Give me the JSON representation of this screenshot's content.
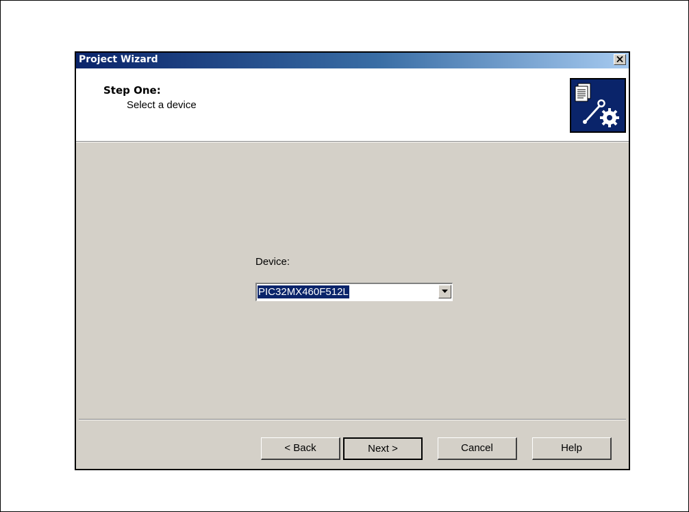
{
  "dialog": {
    "title": "Project Wizard",
    "close_icon": "close-icon"
  },
  "header": {
    "step_title": "Step One:",
    "step_subtitle": "Select a device",
    "icon": "wizard-document-wrench-gear-icon"
  },
  "device": {
    "label": "Device:",
    "selected_value": "PIC32MX460F512L",
    "dropdown_icon": "chevron-down-icon"
  },
  "buttons": {
    "back": "< Back",
    "next": "Next >",
    "cancel": "Cancel",
    "help": "Help"
  },
  "colors": {
    "title_bar_start": "#0a246a",
    "title_bar_end": "#a6caf0",
    "dialog_face": "#d4d0c8",
    "selection": "#0a246a"
  }
}
